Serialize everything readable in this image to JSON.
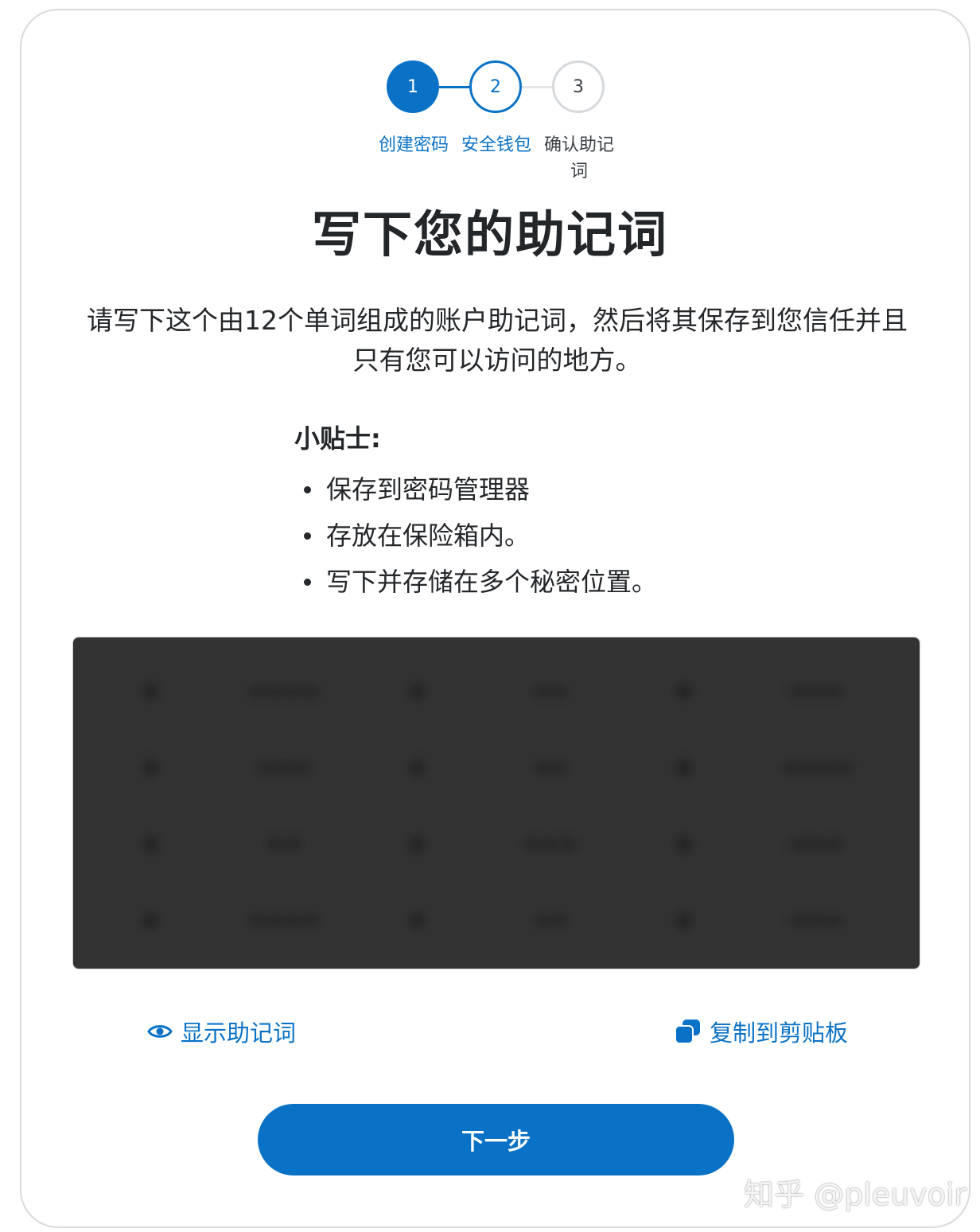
{
  "stepper": {
    "steps": [
      {
        "number": "1",
        "label": "创建密码",
        "state": "completed"
      },
      {
        "number": "2",
        "label": "安全钱包",
        "state": "active"
      },
      {
        "number": "3",
        "label": "确认助记词",
        "state": "pending"
      }
    ]
  },
  "title": "写下您的助记词",
  "description": "请写下这个由12个单词组成的账户助记词，然后将其保存到您信任并且只有您可以访问的地方。",
  "tips": {
    "title": "小贴士:",
    "items": [
      "保存到密码管理器",
      "存放在保险箱内。",
      "写下并存储在多个秘密位置。"
    ]
  },
  "phrase": {
    "hidden": true
  },
  "actions": {
    "reveal_label": "显示助记词",
    "copy_label": "复制到剪贴板"
  },
  "next_button_label": "下一步",
  "watermark": "知乎 @pleuvoir",
  "colors": {
    "accent": "#0a72c6",
    "text": "#24272a",
    "phrase_box": "#333333"
  }
}
